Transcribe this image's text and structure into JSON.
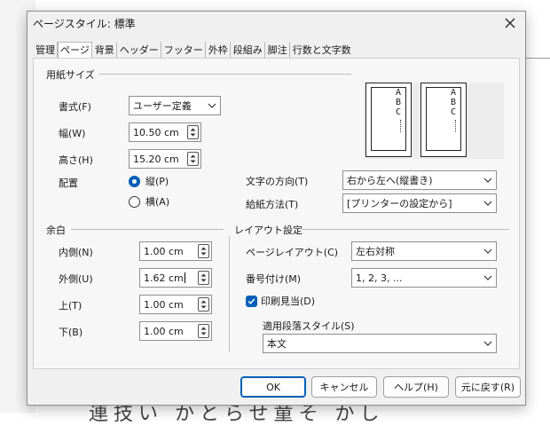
{
  "window": {
    "title": "ページスタイル: 標準"
  },
  "tabs": [
    "管理",
    "ページ",
    "背景",
    "ヘッダー",
    "フッター",
    "外枠",
    "段組み",
    "脚注",
    "行数と文字数"
  ],
  "paper": {
    "section_title": "用紙サイズ",
    "format_label": "書式(F)",
    "format_value": "ユーザー定義",
    "width_label": "幅(W)",
    "width_value": "10.50 cm",
    "height_label": "高さ(H)",
    "height_value": "15.20 cm",
    "orientation_label": "配置",
    "portrait_label": "縦(P)",
    "landscape_label": "横(A)",
    "text_direction_label": "文字の方向(T)",
    "text_direction_value": "右から左へ(縦書き)",
    "paper_tray_label": "給紙方法(T)",
    "paper_tray_value": "[プリンターの設定から]",
    "preview_text": "ABC"
  },
  "margins": {
    "section_title": "余白",
    "inner_label": "内側(N)",
    "inner_value": "1.00 cm",
    "outer_label": "外側(U)",
    "outer_value": "1.62 cm",
    "top_label": "上(T)",
    "top_value": "1.00 cm",
    "bottom_label": "下(B)",
    "bottom_value": "1.00 cm"
  },
  "layout": {
    "section_title": "レイアウト設定",
    "page_layout_label": "ページレイアウト(C)",
    "page_layout_value": "左右対称",
    "numbering_label": "番号付け(M)",
    "numbering_value": "1, 2, 3, ...",
    "register_true_label": "印刷見当(D)",
    "reference_style_label": "適用段落スタイル(S)",
    "reference_style_value": "本文"
  },
  "buttons": {
    "ok": "OK",
    "cancel": "キャンセル",
    "help": "ヘルプ(H)",
    "reset": "元に戻す(R)"
  },
  "colors": {
    "accent": "#005fb8"
  },
  "background_doc": {
    "text": "連技い かとらせ童そ かし"
  }
}
